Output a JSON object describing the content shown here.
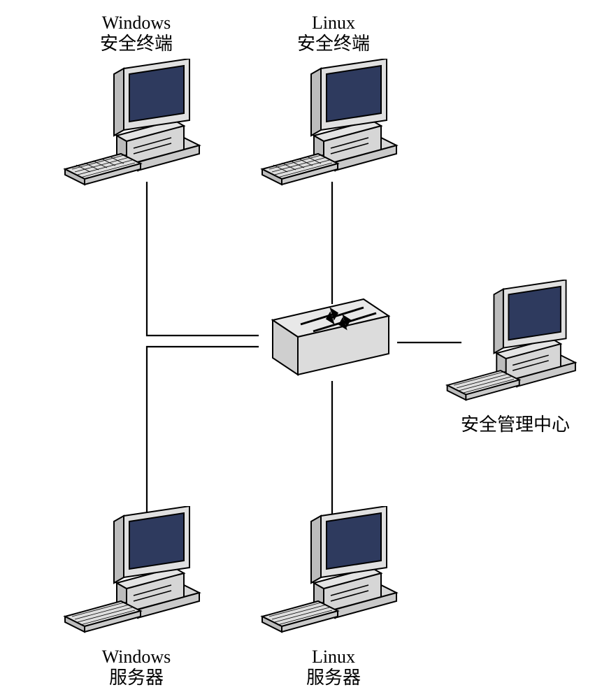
{
  "nodes": {
    "top_left": {
      "line1": "Windows",
      "line2": "安全终端"
    },
    "top_right": {
      "line1": "Linux",
      "line2": "安全终端"
    },
    "right": {
      "line1": "安全管理中心"
    },
    "bottom_left": {
      "line1": "Windows",
      "line2": "服务器"
    },
    "bottom_right": {
      "line1": "Linux",
      "line2": "服务器"
    }
  }
}
